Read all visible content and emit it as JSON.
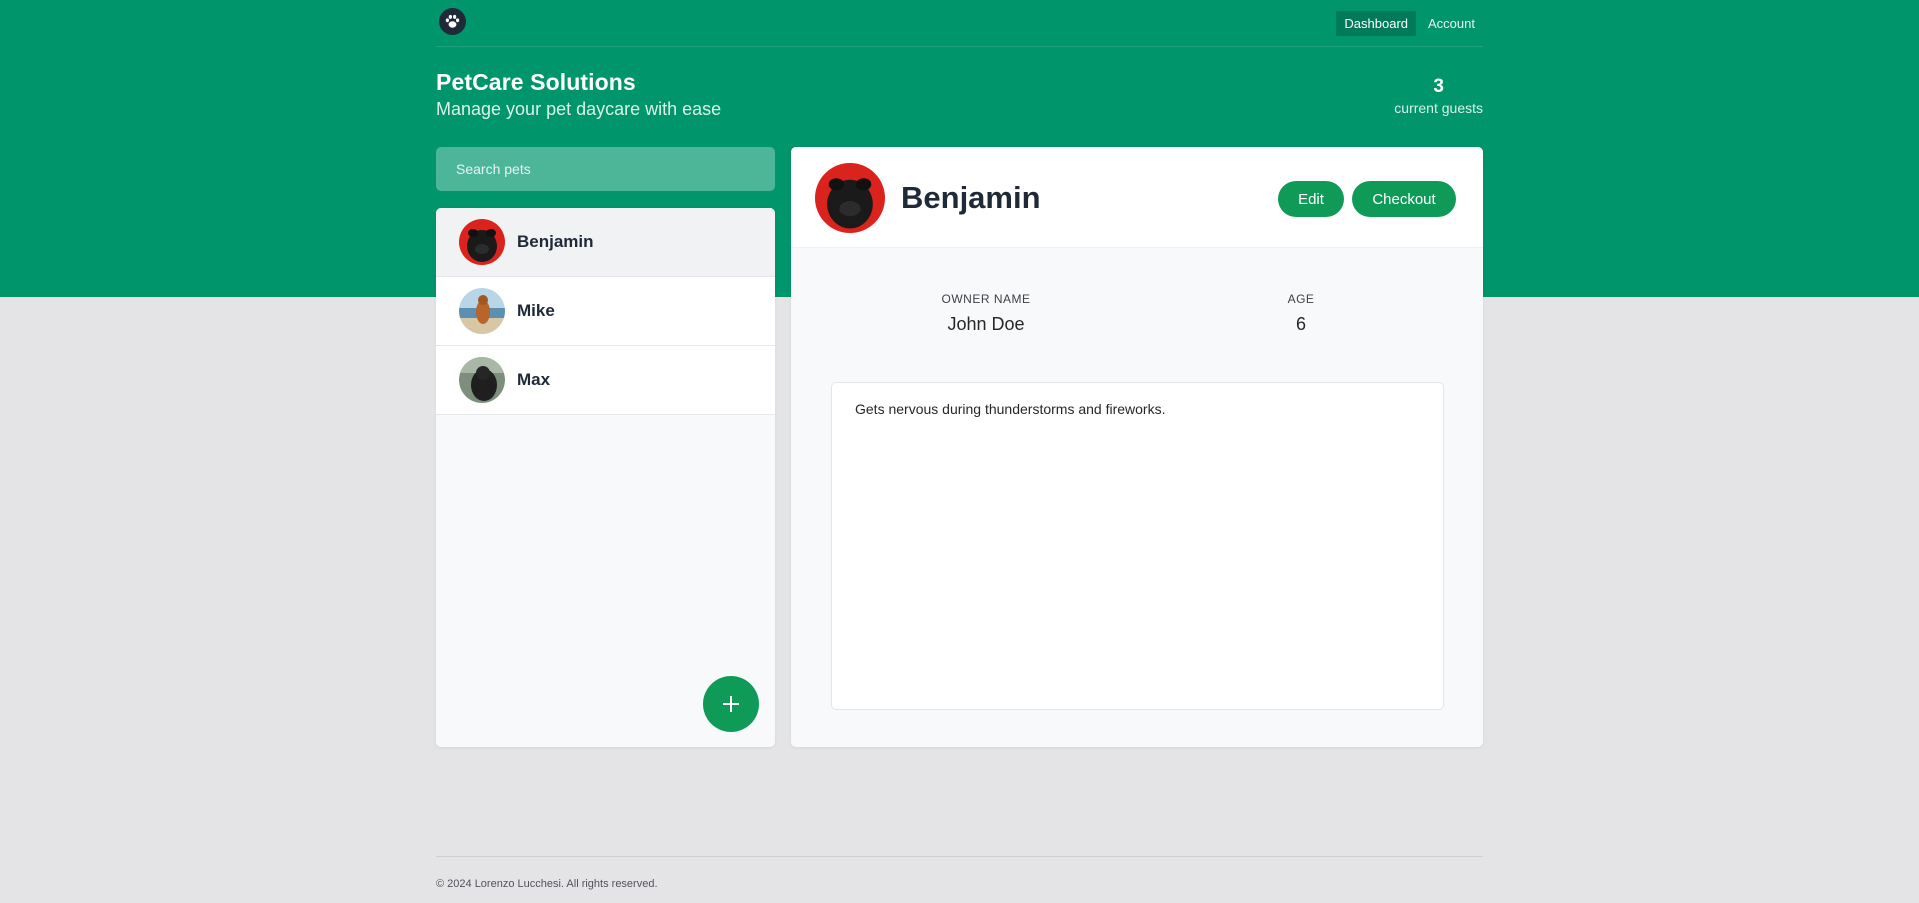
{
  "nav": {
    "logo_icon": "paw-icon",
    "links": [
      {
        "label": "Dashboard",
        "active": true
      },
      {
        "label": "Account",
        "active": false
      }
    ]
  },
  "header": {
    "title": "PetCare Solutions",
    "subtitle": "Manage your pet daycare with ease",
    "guest_count": "3",
    "guest_label": "current guests"
  },
  "search": {
    "placeholder": "Search pets",
    "value": ""
  },
  "pets": [
    {
      "name": "Benjamin",
      "selected": true
    },
    {
      "name": "Mike",
      "selected": false
    },
    {
      "name": "Max",
      "selected": false
    }
  ],
  "add_button_icon": "plus-icon",
  "detail": {
    "name": "Benjamin",
    "edit_label": "Edit",
    "checkout_label": "Checkout",
    "owner_label": "OWNER NAME",
    "owner_value": "John Doe",
    "age_label": "AGE",
    "age_value": "6",
    "notes": "Gets nervous during thunderstorms and fireworks."
  },
  "footer": {
    "text": "© 2024 Lorenzo Lucchesi. All rights reserved."
  },
  "colors": {
    "brand_green": "#01956c",
    "button_green": "#0f9b57",
    "page_bg": "#e4e4e7"
  }
}
